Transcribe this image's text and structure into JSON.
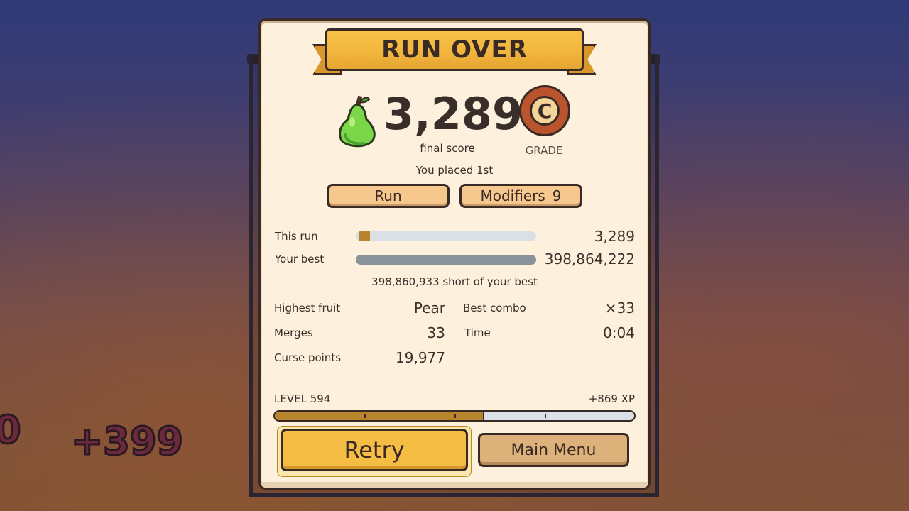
{
  "background": {
    "floating_text_left": "0",
    "floating_text_right": "+399"
  },
  "header": {
    "title": "RUN OVER"
  },
  "result": {
    "fruit_icon": "pear-icon",
    "score": "3,289",
    "score_caption": "final score",
    "grade": "C",
    "grade_caption": "GRADE",
    "placement": "You placed 1st"
  },
  "tabs": {
    "run_label": "Run",
    "modifiers_label": "Modifiers",
    "modifiers_count": "9"
  },
  "comparison": {
    "this_run_label": "This run",
    "this_run_value": "3,289",
    "this_run_fraction": 0.00825,
    "best_label": "Your best",
    "best_value": "398,864,222",
    "best_fraction": 1.0,
    "short_text": "398,860,933 short of your best"
  },
  "stats": {
    "highest_fruit_label": "Highest fruit",
    "highest_fruit_value": "Pear",
    "best_combo_label": "Best combo",
    "best_combo_value": "×33",
    "merges_label": "Merges",
    "merges_value": "33",
    "time_label": "Time",
    "time_value": "0:04",
    "curse_label": "Curse points",
    "curse_value": "19,977"
  },
  "xp": {
    "level_text": "LEVEL 594",
    "gain_text": "+869 XP",
    "progress_fraction": 0.58
  },
  "buttons": {
    "retry_label": "Retry",
    "menu_label": "Main Menu"
  },
  "colors": {
    "panel": "#fdf0dc",
    "ribbon": "#f2b43c",
    "accent_bar": "#b8842c",
    "best_bar": "#8a929a",
    "retry": "#f6bd44",
    "menu": "#dcb27a"
  }
}
